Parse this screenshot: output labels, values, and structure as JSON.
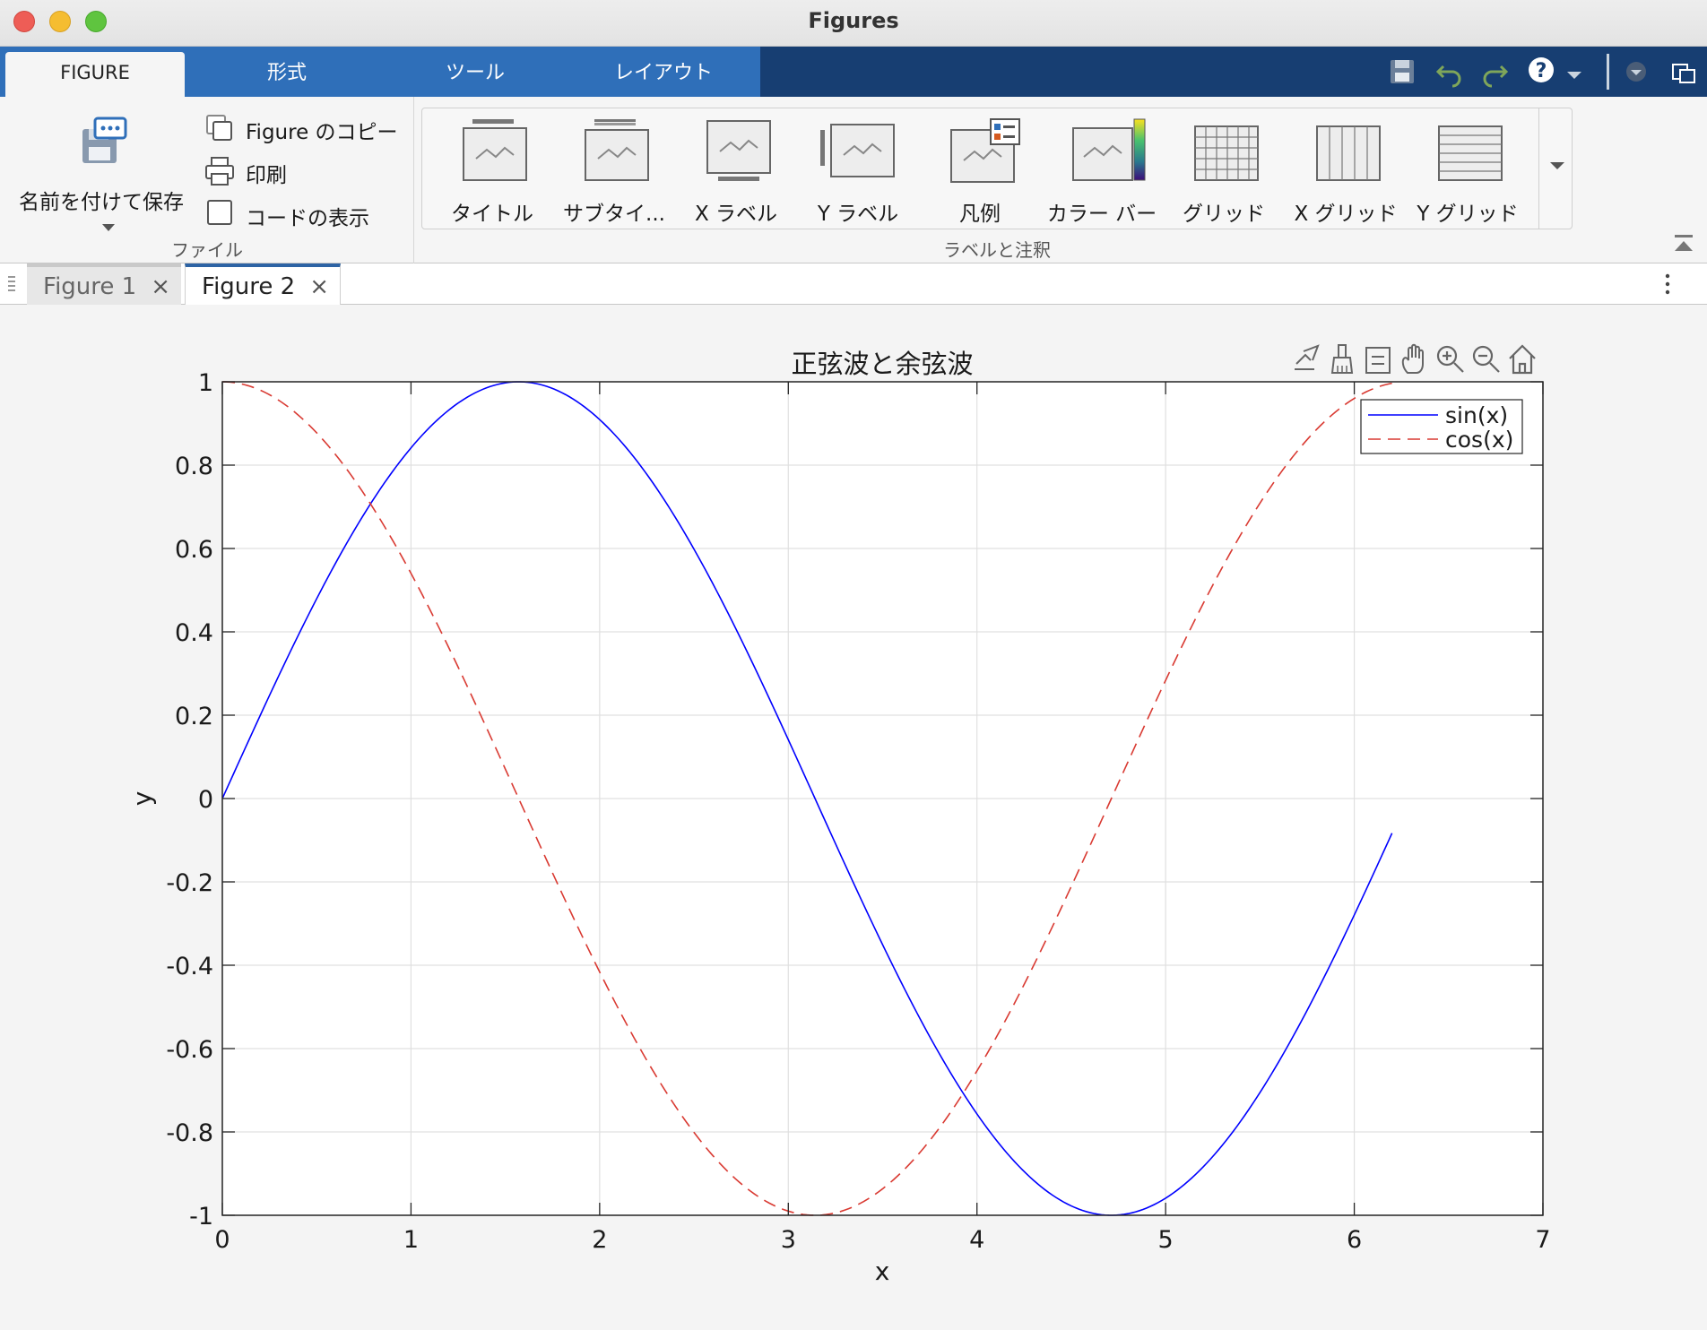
{
  "window": {
    "title": "Figures"
  },
  "ribbon_tabs": [
    {
      "label": "FIGURE",
      "active": true
    },
    {
      "label": "形式",
      "active": false
    },
    {
      "label": "ツール",
      "active": false
    },
    {
      "label": "レイアウト",
      "active": false
    }
  ],
  "file_group": {
    "save_as_label": "名前を付けて保存",
    "copy_figure_label": "Figure のコピー",
    "print_label": "印刷",
    "show_code_label": "コードの表示",
    "group_label": "ファイル"
  },
  "labels_group": {
    "items": [
      "タイトル",
      "サブタイ...",
      "X ラベル",
      "Y ラベル",
      "凡例",
      "カラー バー",
      "グリッド",
      "X グリッド",
      "Y グリッド"
    ],
    "group_label": "ラベルと注釈"
  },
  "doc_tabs": [
    {
      "label": "Figure 1",
      "active": false
    },
    {
      "label": "Figure 2",
      "active": true
    }
  ],
  "colors": {
    "sin": "#0000ff",
    "cos": "#d93a32",
    "ribbon": "#2f6fb9",
    "ribbon_dark": "#173e72"
  },
  "chart_data": {
    "type": "line",
    "title": "正弦波と余弦波",
    "xlabel": "x",
    "ylabel": "y",
    "xlim": [
      0,
      7
    ],
    "ylim": [
      -1,
      1
    ],
    "xticks": [
      0,
      1,
      2,
      3,
      4,
      5,
      6,
      7
    ],
    "yticks": [
      -1,
      -0.8,
      -0.6,
      -0.4,
      -0.2,
      0,
      0.2,
      0.4,
      0.6,
      0.8,
      1
    ],
    "xtick_labels": [
      "0",
      "1",
      "2",
      "3",
      "4",
      "5",
      "6",
      "7"
    ],
    "ytick_labels": [
      "-1",
      "-0.8",
      "-0.6",
      "-0.4",
      "-0.2",
      "0",
      "0.2",
      "0.4",
      "0.6",
      "0.8",
      "1"
    ],
    "grid": true,
    "legend": "top-right",
    "x_range": [
      0,
      6.2
    ],
    "series": [
      {
        "name": "sin(x)",
        "function": "sin",
        "style": "solid",
        "color": "#0000ff"
      },
      {
        "name": "cos(x)",
        "function": "cos",
        "style": "dashed",
        "color": "#d93a32"
      }
    ]
  }
}
